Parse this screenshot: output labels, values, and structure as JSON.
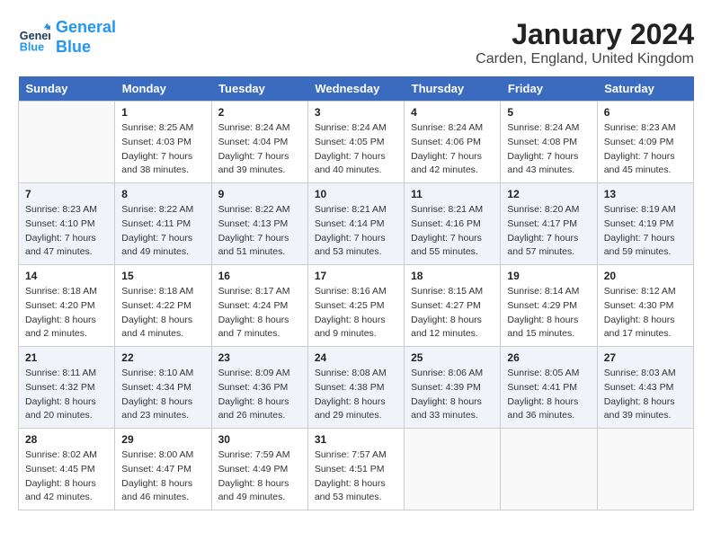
{
  "header": {
    "logo_line1": "General",
    "logo_line2": "Blue",
    "month": "January 2024",
    "location": "Carden, England, United Kingdom"
  },
  "days_of_week": [
    "Sunday",
    "Monday",
    "Tuesday",
    "Wednesday",
    "Thursday",
    "Friday",
    "Saturday"
  ],
  "weeks": [
    [
      {
        "day": "",
        "sunrise": "",
        "sunset": "",
        "daylight": "",
        "empty": true
      },
      {
        "day": "1",
        "sunrise": "Sunrise: 8:25 AM",
        "sunset": "Sunset: 4:03 PM",
        "daylight": "Daylight: 7 hours and 38 minutes."
      },
      {
        "day": "2",
        "sunrise": "Sunrise: 8:24 AM",
        "sunset": "Sunset: 4:04 PM",
        "daylight": "Daylight: 7 hours and 39 minutes."
      },
      {
        "day": "3",
        "sunrise": "Sunrise: 8:24 AM",
        "sunset": "Sunset: 4:05 PM",
        "daylight": "Daylight: 7 hours and 40 minutes."
      },
      {
        "day": "4",
        "sunrise": "Sunrise: 8:24 AM",
        "sunset": "Sunset: 4:06 PM",
        "daylight": "Daylight: 7 hours and 42 minutes."
      },
      {
        "day": "5",
        "sunrise": "Sunrise: 8:24 AM",
        "sunset": "Sunset: 4:08 PM",
        "daylight": "Daylight: 7 hours and 43 minutes."
      },
      {
        "day": "6",
        "sunrise": "Sunrise: 8:23 AM",
        "sunset": "Sunset: 4:09 PM",
        "daylight": "Daylight: 7 hours and 45 minutes."
      }
    ],
    [
      {
        "day": "7",
        "sunrise": "Sunrise: 8:23 AM",
        "sunset": "Sunset: 4:10 PM",
        "daylight": "Daylight: 7 hours and 47 minutes."
      },
      {
        "day": "8",
        "sunrise": "Sunrise: 8:22 AM",
        "sunset": "Sunset: 4:11 PM",
        "daylight": "Daylight: 7 hours and 49 minutes."
      },
      {
        "day": "9",
        "sunrise": "Sunrise: 8:22 AM",
        "sunset": "Sunset: 4:13 PM",
        "daylight": "Daylight: 7 hours and 51 minutes."
      },
      {
        "day": "10",
        "sunrise": "Sunrise: 8:21 AM",
        "sunset": "Sunset: 4:14 PM",
        "daylight": "Daylight: 7 hours and 53 minutes."
      },
      {
        "day": "11",
        "sunrise": "Sunrise: 8:21 AM",
        "sunset": "Sunset: 4:16 PM",
        "daylight": "Daylight: 7 hours and 55 minutes."
      },
      {
        "day": "12",
        "sunrise": "Sunrise: 8:20 AM",
        "sunset": "Sunset: 4:17 PM",
        "daylight": "Daylight: 7 hours and 57 minutes."
      },
      {
        "day": "13",
        "sunrise": "Sunrise: 8:19 AM",
        "sunset": "Sunset: 4:19 PM",
        "daylight": "Daylight: 7 hours and 59 minutes."
      }
    ],
    [
      {
        "day": "14",
        "sunrise": "Sunrise: 8:18 AM",
        "sunset": "Sunset: 4:20 PM",
        "daylight": "Daylight: 8 hours and 2 minutes."
      },
      {
        "day": "15",
        "sunrise": "Sunrise: 8:18 AM",
        "sunset": "Sunset: 4:22 PM",
        "daylight": "Daylight: 8 hours and 4 minutes."
      },
      {
        "day": "16",
        "sunrise": "Sunrise: 8:17 AM",
        "sunset": "Sunset: 4:24 PM",
        "daylight": "Daylight: 8 hours and 7 minutes."
      },
      {
        "day": "17",
        "sunrise": "Sunrise: 8:16 AM",
        "sunset": "Sunset: 4:25 PM",
        "daylight": "Daylight: 8 hours and 9 minutes."
      },
      {
        "day": "18",
        "sunrise": "Sunrise: 8:15 AM",
        "sunset": "Sunset: 4:27 PM",
        "daylight": "Daylight: 8 hours and 12 minutes."
      },
      {
        "day": "19",
        "sunrise": "Sunrise: 8:14 AM",
        "sunset": "Sunset: 4:29 PM",
        "daylight": "Daylight: 8 hours and 15 minutes."
      },
      {
        "day": "20",
        "sunrise": "Sunrise: 8:12 AM",
        "sunset": "Sunset: 4:30 PM",
        "daylight": "Daylight: 8 hours and 17 minutes."
      }
    ],
    [
      {
        "day": "21",
        "sunrise": "Sunrise: 8:11 AM",
        "sunset": "Sunset: 4:32 PM",
        "daylight": "Daylight: 8 hours and 20 minutes."
      },
      {
        "day": "22",
        "sunrise": "Sunrise: 8:10 AM",
        "sunset": "Sunset: 4:34 PM",
        "daylight": "Daylight: 8 hours and 23 minutes."
      },
      {
        "day": "23",
        "sunrise": "Sunrise: 8:09 AM",
        "sunset": "Sunset: 4:36 PM",
        "daylight": "Daylight: 8 hours and 26 minutes."
      },
      {
        "day": "24",
        "sunrise": "Sunrise: 8:08 AM",
        "sunset": "Sunset: 4:38 PM",
        "daylight": "Daylight: 8 hours and 29 minutes."
      },
      {
        "day": "25",
        "sunrise": "Sunrise: 8:06 AM",
        "sunset": "Sunset: 4:39 PM",
        "daylight": "Daylight: 8 hours and 33 minutes."
      },
      {
        "day": "26",
        "sunrise": "Sunrise: 8:05 AM",
        "sunset": "Sunset: 4:41 PM",
        "daylight": "Daylight: 8 hours and 36 minutes."
      },
      {
        "day": "27",
        "sunrise": "Sunrise: 8:03 AM",
        "sunset": "Sunset: 4:43 PM",
        "daylight": "Daylight: 8 hours and 39 minutes."
      }
    ],
    [
      {
        "day": "28",
        "sunrise": "Sunrise: 8:02 AM",
        "sunset": "Sunset: 4:45 PM",
        "daylight": "Daylight: 8 hours and 42 minutes."
      },
      {
        "day": "29",
        "sunrise": "Sunrise: 8:00 AM",
        "sunset": "Sunset: 4:47 PM",
        "daylight": "Daylight: 8 hours and 46 minutes."
      },
      {
        "day": "30",
        "sunrise": "Sunrise: 7:59 AM",
        "sunset": "Sunset: 4:49 PM",
        "daylight": "Daylight: 8 hours and 49 minutes."
      },
      {
        "day": "31",
        "sunrise": "Sunrise: 7:57 AM",
        "sunset": "Sunset: 4:51 PM",
        "daylight": "Daylight: 8 hours and 53 minutes."
      },
      {
        "day": "",
        "sunrise": "",
        "sunset": "",
        "daylight": "",
        "empty": true
      },
      {
        "day": "",
        "sunrise": "",
        "sunset": "",
        "daylight": "",
        "empty": true
      },
      {
        "day": "",
        "sunrise": "",
        "sunset": "",
        "daylight": "",
        "empty": true
      }
    ]
  ]
}
